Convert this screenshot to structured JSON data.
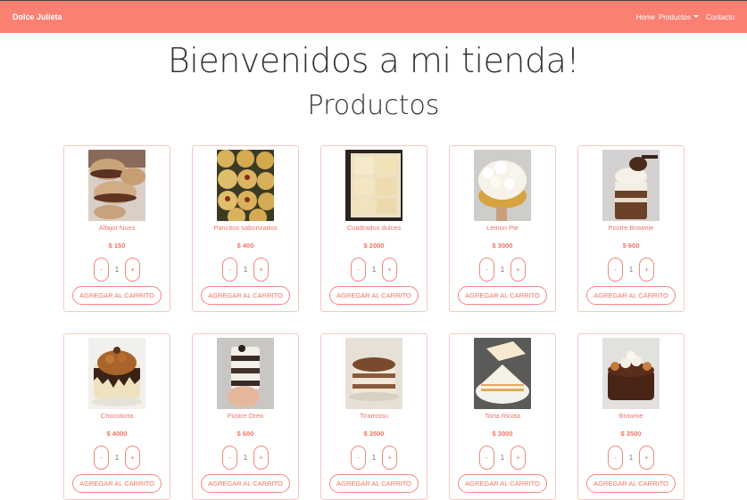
{
  "navbar": {
    "brand": "Dolce Julieta",
    "links": [
      "Home",
      "Productos",
      "Contacto"
    ]
  },
  "welcome": "Bienvenidos a mi tienda!",
  "section_title": "Productos",
  "add_to_cart_label": "AGREGAR AL CARRITO",
  "minus_label": "-",
  "plus_label": "+",
  "products": [
    {
      "name": "Alfajor Nuez",
      "price": "$ 150",
      "qty": "1",
      "image": "alfajor-photo"
    },
    {
      "name": "Pancitos saborizados",
      "price": "$ 400",
      "qty": "1",
      "image": "pancitos-photo"
    },
    {
      "name": "Cuadrados dulces",
      "price": "$ 2000",
      "qty": "1",
      "image": "cuadrados-photo"
    },
    {
      "name": "Lemon Pie",
      "price": "$ 3000",
      "qty": "1",
      "image": "lemon-pie-photo"
    },
    {
      "name": "Postre Brownie",
      "price": "$ 600",
      "qty": "1",
      "image": "postre-brownie-photo"
    },
    {
      "name": "Chocotorta",
      "price": "$ 4000",
      "qty": "1",
      "image": "chocotorta-photo"
    },
    {
      "name": "Postre Oreo",
      "price": "$ 600",
      "qty": "1",
      "image": "postre-oreo-photo"
    },
    {
      "name": "Tiramissu",
      "price": "$ 3500",
      "qty": "1",
      "image": "tiramissu-photo"
    },
    {
      "name": "Torta Ricota",
      "price": "$ 3000",
      "qty": "1",
      "image": "torta-ricota-photo"
    },
    {
      "name": "Brownie",
      "price": "$ 3500",
      "qty": "1",
      "image": "brownie-photo"
    }
  ],
  "colors": {
    "navbar": "#fa8072",
    "accent": "#f07466"
  }
}
